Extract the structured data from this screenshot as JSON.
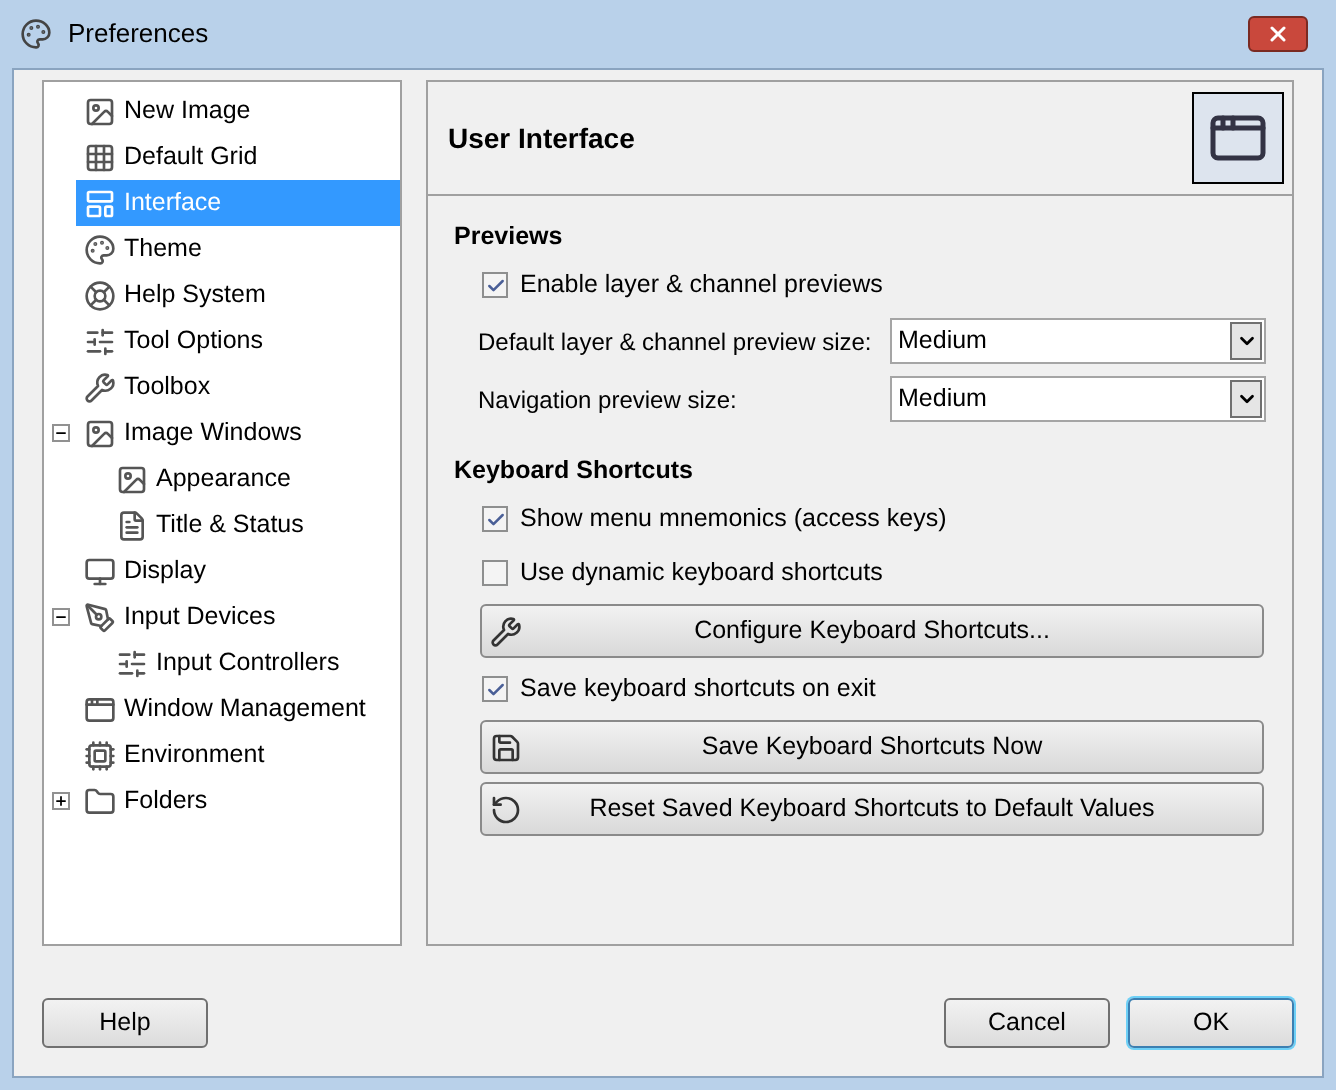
{
  "window": {
    "title": "Preferences"
  },
  "sidebar": {
    "items": [
      {
        "label": "New Image",
        "selected": false
      },
      {
        "label": "Default Grid",
        "selected": false
      },
      {
        "label": "Interface",
        "selected": true
      },
      {
        "label": "Theme",
        "selected": false
      },
      {
        "label": "Help System",
        "selected": false
      },
      {
        "label": "Tool Options",
        "selected": false
      },
      {
        "label": "Toolbox",
        "selected": false
      },
      {
        "label": "Image Windows",
        "selected": false,
        "expanded": true,
        "children": [
          {
            "label": "Appearance",
            "selected": false
          },
          {
            "label": "Title & Status",
            "selected": false
          }
        ]
      },
      {
        "label": "Display",
        "selected": false
      },
      {
        "label": "Input Devices",
        "selected": false,
        "expanded": true,
        "children": [
          {
            "label": "Input Controllers",
            "selected": false
          }
        ]
      },
      {
        "label": "Window Management",
        "selected": false
      },
      {
        "label": "Environment",
        "selected": false
      },
      {
        "label": "Folders",
        "selected": false,
        "expanded": false
      }
    ]
  },
  "page": {
    "title": "User Interface",
    "sections": [
      {
        "heading": "Previews",
        "rows": [
          {
            "kind": "checkbox",
            "label": "Enable layer & channel previews",
            "checked": true
          },
          {
            "kind": "select",
            "label": "Default layer & channel preview size:",
            "value": "Medium"
          },
          {
            "kind": "select",
            "label": "Navigation preview size:",
            "value": "Medium"
          }
        ]
      },
      {
        "heading": "Keyboard Shortcuts",
        "rows": [
          {
            "kind": "checkbox",
            "label": "Show menu mnemonics (access keys)",
            "checked": true
          },
          {
            "kind": "checkbox",
            "label": "Use dynamic keyboard shortcuts",
            "checked": false
          },
          {
            "kind": "button",
            "label": "Configure Keyboard Shortcuts..."
          },
          {
            "kind": "checkbox",
            "label": "Save keyboard shortcuts on exit",
            "checked": true
          },
          {
            "kind": "button",
            "label": "Save Keyboard Shortcuts Now"
          },
          {
            "kind": "button",
            "label": "Reset Saved Keyboard Shortcuts to Default Values"
          }
        ]
      }
    ]
  },
  "footer": {
    "left": [
      {
        "label": "Help",
        "default": false
      }
    ],
    "right": [
      {
        "label": "Cancel",
        "default": false
      },
      {
        "label": "OK",
        "default": true
      }
    ]
  }
}
